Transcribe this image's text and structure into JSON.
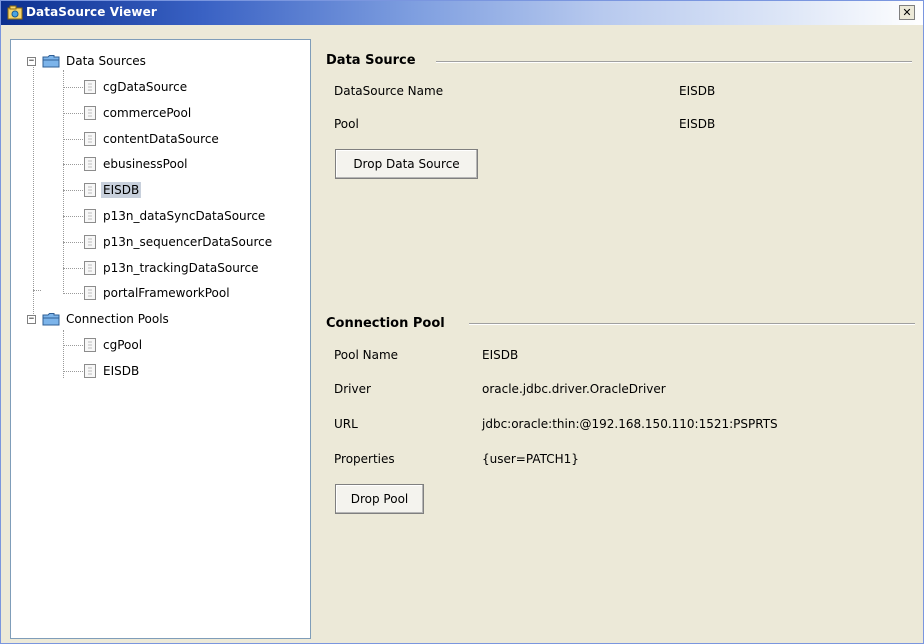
{
  "window": {
    "title": "DataSource Viewer",
    "close_glyph": "✕"
  },
  "tree": {
    "root1": {
      "label": "Data Sources",
      "items": [
        "cgDataSource",
        "commercePool",
        "contentDataSource",
        "ebusinessPool",
        "EISDB",
        "p13n_dataSyncDataSource",
        "p13n_sequencerDataSource",
        "p13n_trackingDataSource",
        "portalFrameworkPool"
      ],
      "selected_index": 4
    },
    "root2": {
      "label": "Connection Pools",
      "items": [
        "cgPool",
        "EISDB"
      ]
    },
    "expander_glyph": "−"
  },
  "datasource": {
    "heading": "Data Source",
    "name_label": "DataSource Name",
    "name_value": "EISDB",
    "pool_label": "Pool",
    "pool_value": "EISDB",
    "drop_button": "Drop Data Source"
  },
  "pool": {
    "heading": "Connection Pool",
    "name_label": "Pool Name",
    "name_value": "EISDB",
    "driver_label": "Driver",
    "driver_value": "oracle.jdbc.driver.OracleDriver",
    "url_label": "URL",
    "url_value": "jdbc:oracle:thin:@192.168.150.110:1521:PSPRTS",
    "properties_label": "Properties",
    "properties_value": "{user=PATCH1}",
    "drop_button": "Drop Pool"
  },
  "icons": {
    "app": "datasource-viewer-icon",
    "folder": "folder-icon",
    "file": "document-icon",
    "close": "close-icon"
  }
}
